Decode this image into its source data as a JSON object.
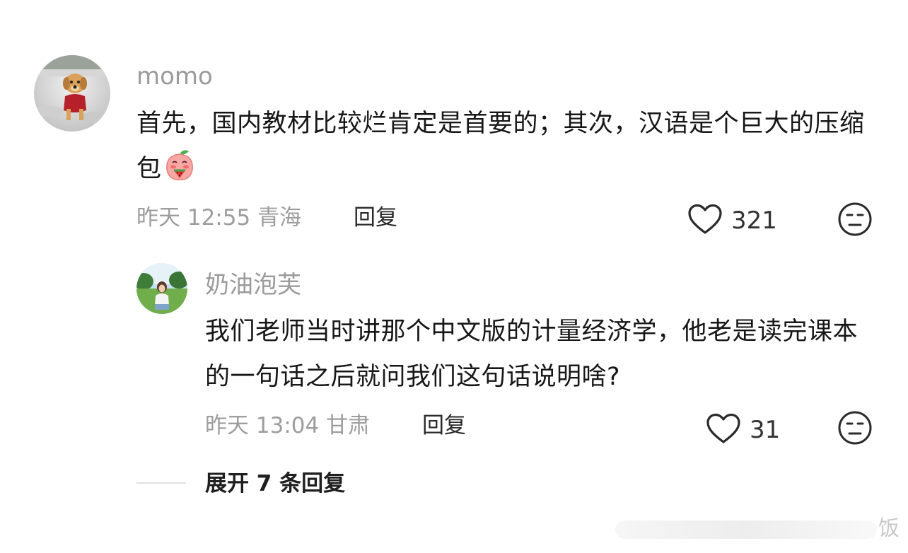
{
  "comments": [
    {
      "username": "momo",
      "content": "首先，国内教材比较烂肯定是首要的；其次，汉语是个巨大的压缩包",
      "time": "昨天 12:55",
      "location": "青海",
      "reply_label": "回复",
      "likes": "321",
      "inline_emoji": "peach-eating-watermelon"
    },
    {
      "username": "奶油泡芙",
      "content": "我们老师当时讲那个中文版的计量经济学，他老是读完课本的一句话之后就问我们这句话说明啥?",
      "time": "昨天 13:04",
      "location": "甘肃",
      "reply_label": "回复",
      "likes": "31"
    }
  ],
  "expand_replies": "展开 7 条回复",
  "watermark": "饭",
  "icons": {
    "like": "heart-outline-icon",
    "reaction": "neutral-face-icon"
  },
  "colors": {
    "secondary_text": "#9b9b9b",
    "primary_text": "#171717"
  }
}
